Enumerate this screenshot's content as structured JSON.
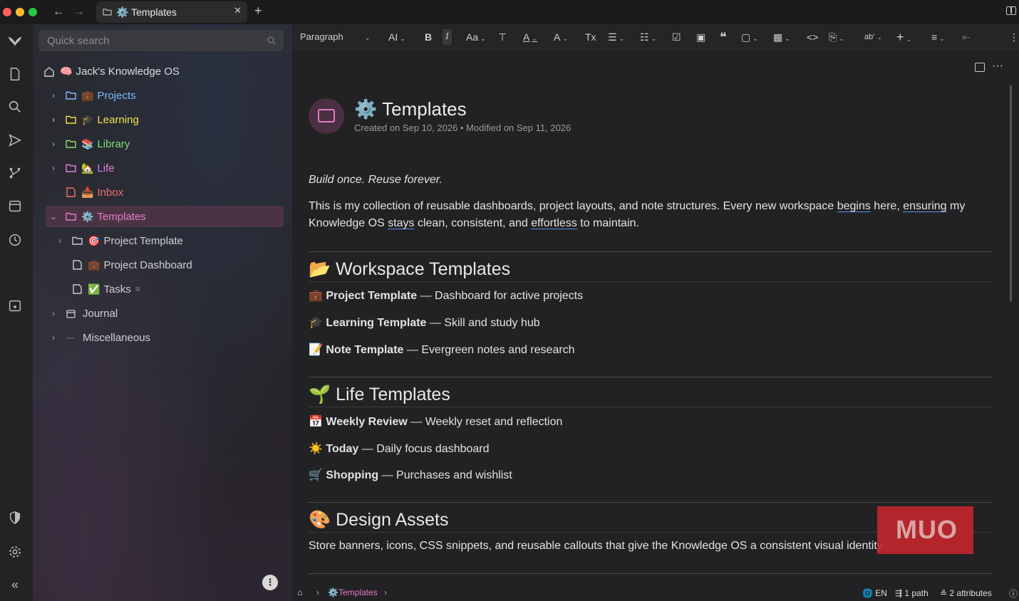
{
  "window": {
    "tab_title": "Templates"
  },
  "sidebar": {
    "search_placeholder": "Quick search",
    "root": {
      "label": "Jack's Knowledge OS",
      "emoji": "🧠"
    },
    "items": [
      {
        "label": "Projects",
        "emoji": "💼",
        "color": "#7fb7ff"
      },
      {
        "label": "Learning",
        "emoji": "🎓",
        "color": "#f1e04f"
      },
      {
        "label": "Library",
        "emoji": "📚",
        "color": "#7ee06f"
      },
      {
        "label": "Life",
        "emoji": "🏡",
        "color": "#e07fe6"
      },
      {
        "label": "Inbox",
        "emoji": "📥",
        "color": "#f07070"
      },
      {
        "label": "Templates",
        "emoji": "⚙️",
        "color": "#e57ac3"
      },
      {
        "label": "Project Template",
        "emoji": "🎯",
        "color": "#d0d0d0"
      },
      {
        "label": "Project Dashboard",
        "emoji": "💼",
        "color": "#d0d0d0"
      },
      {
        "label": "Tasks",
        "emoji": "✅",
        "color": "#d0d0d0"
      },
      {
        "label": "Journal",
        "emoji": "",
        "color": "#d0d0d0"
      },
      {
        "label": "Miscellaneous",
        "emoji": "",
        "color": "#d0d0d0"
      }
    ]
  },
  "toolbar": {
    "block_type": "Paragraph"
  },
  "note": {
    "title": "Templates",
    "title_emoji": "⚙️",
    "meta": "Created on Sep 10, 2026 • Modified on Sep 11, 2026",
    "tagline": "Build once. Reuse forever.",
    "intro_1": "This is my collection of reusable dashboards, project layouts, and note structures. Every new workspace ",
    "intro_begins": "begins",
    "intro_2": " here, ",
    "intro_ensuring": "ensuring",
    "intro_3": " my Knowledge OS ",
    "intro_stays": "stays",
    "intro_4": " clean, consistent, and ",
    "intro_effortless": "effortless",
    "intro_5": " to maintain.",
    "sections": [
      {
        "heading": "Workspace Templates",
        "emoji": "📂",
        "items": [
          {
            "emoji": "💼",
            "name": "Project Template",
            "desc": " — Dashboard for active projects"
          },
          {
            "emoji": "🎓",
            "name": "Learning Template",
            "desc": " — Skill and study hub"
          },
          {
            "emoji": "📝",
            "name": "Note Template",
            "desc": " — Evergreen notes and research"
          }
        ]
      },
      {
        "heading": "Life Templates",
        "emoji": "🌱",
        "items": [
          {
            "emoji": "📅",
            "name": "Weekly Review",
            "desc": " — Weekly reset and reflection"
          },
          {
            "emoji": "☀️",
            "name": "Today",
            "desc": " — Daily focus dashboard"
          },
          {
            "emoji": "🛒",
            "name": "Shopping",
            "desc": " — Purchases and wishlist"
          }
        ]
      },
      {
        "heading": "Design Assets",
        "emoji": "🎨",
        "text": "Store banners, icons, CSS snippets, and reusable callouts that give the Knowledge OS a consistent visual identity."
      }
    ]
  },
  "statusbar": {
    "breadcrumb": "Templates",
    "lang": "EN",
    "paths": "1 path",
    "attributes": "2 attributes"
  },
  "watermark": "MUO"
}
